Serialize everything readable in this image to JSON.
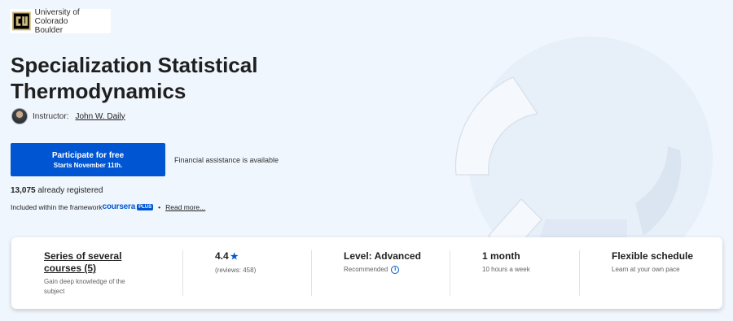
{
  "logo": {
    "name_line1": "University of Colorado",
    "name_line2": "Boulder",
    "icon": "cu-boulder-logo"
  },
  "page_title": "Specialization Statistical Thermodynamics",
  "instructor": {
    "label": "Instructor:",
    "name": "John W. Daily"
  },
  "cta": {
    "main_label": "Participate for free",
    "sub_label": "Starts November 11th.",
    "color": "#0056d2"
  },
  "financial_aid": "Financial assistance is available",
  "registered": {
    "count": "13,075",
    "suffix": "already registered"
  },
  "included": {
    "prefix": "Included within the framework",
    "brand": "coursera",
    "badge": "PLUS",
    "separator": "•",
    "read_more": "Read more..."
  },
  "info_cards": [
    {
      "title": "Series of several courses (5)",
      "subtitle": "Gain deep knowledge of the subject"
    },
    {
      "title": "4.4",
      "subtitle": "(reviews: 458)",
      "icon": "star-icon"
    },
    {
      "title": "Level: Advanced",
      "subtitle": "Recommended",
      "icon": "info-icon"
    },
    {
      "title": "1 month",
      "subtitle": "10 hours a week"
    },
    {
      "title": "Flexible schedule",
      "subtitle": "Learn at your own pace"
    }
  ],
  "colors": {
    "background": "#f0f6fd",
    "accent": "#0056d2"
  }
}
